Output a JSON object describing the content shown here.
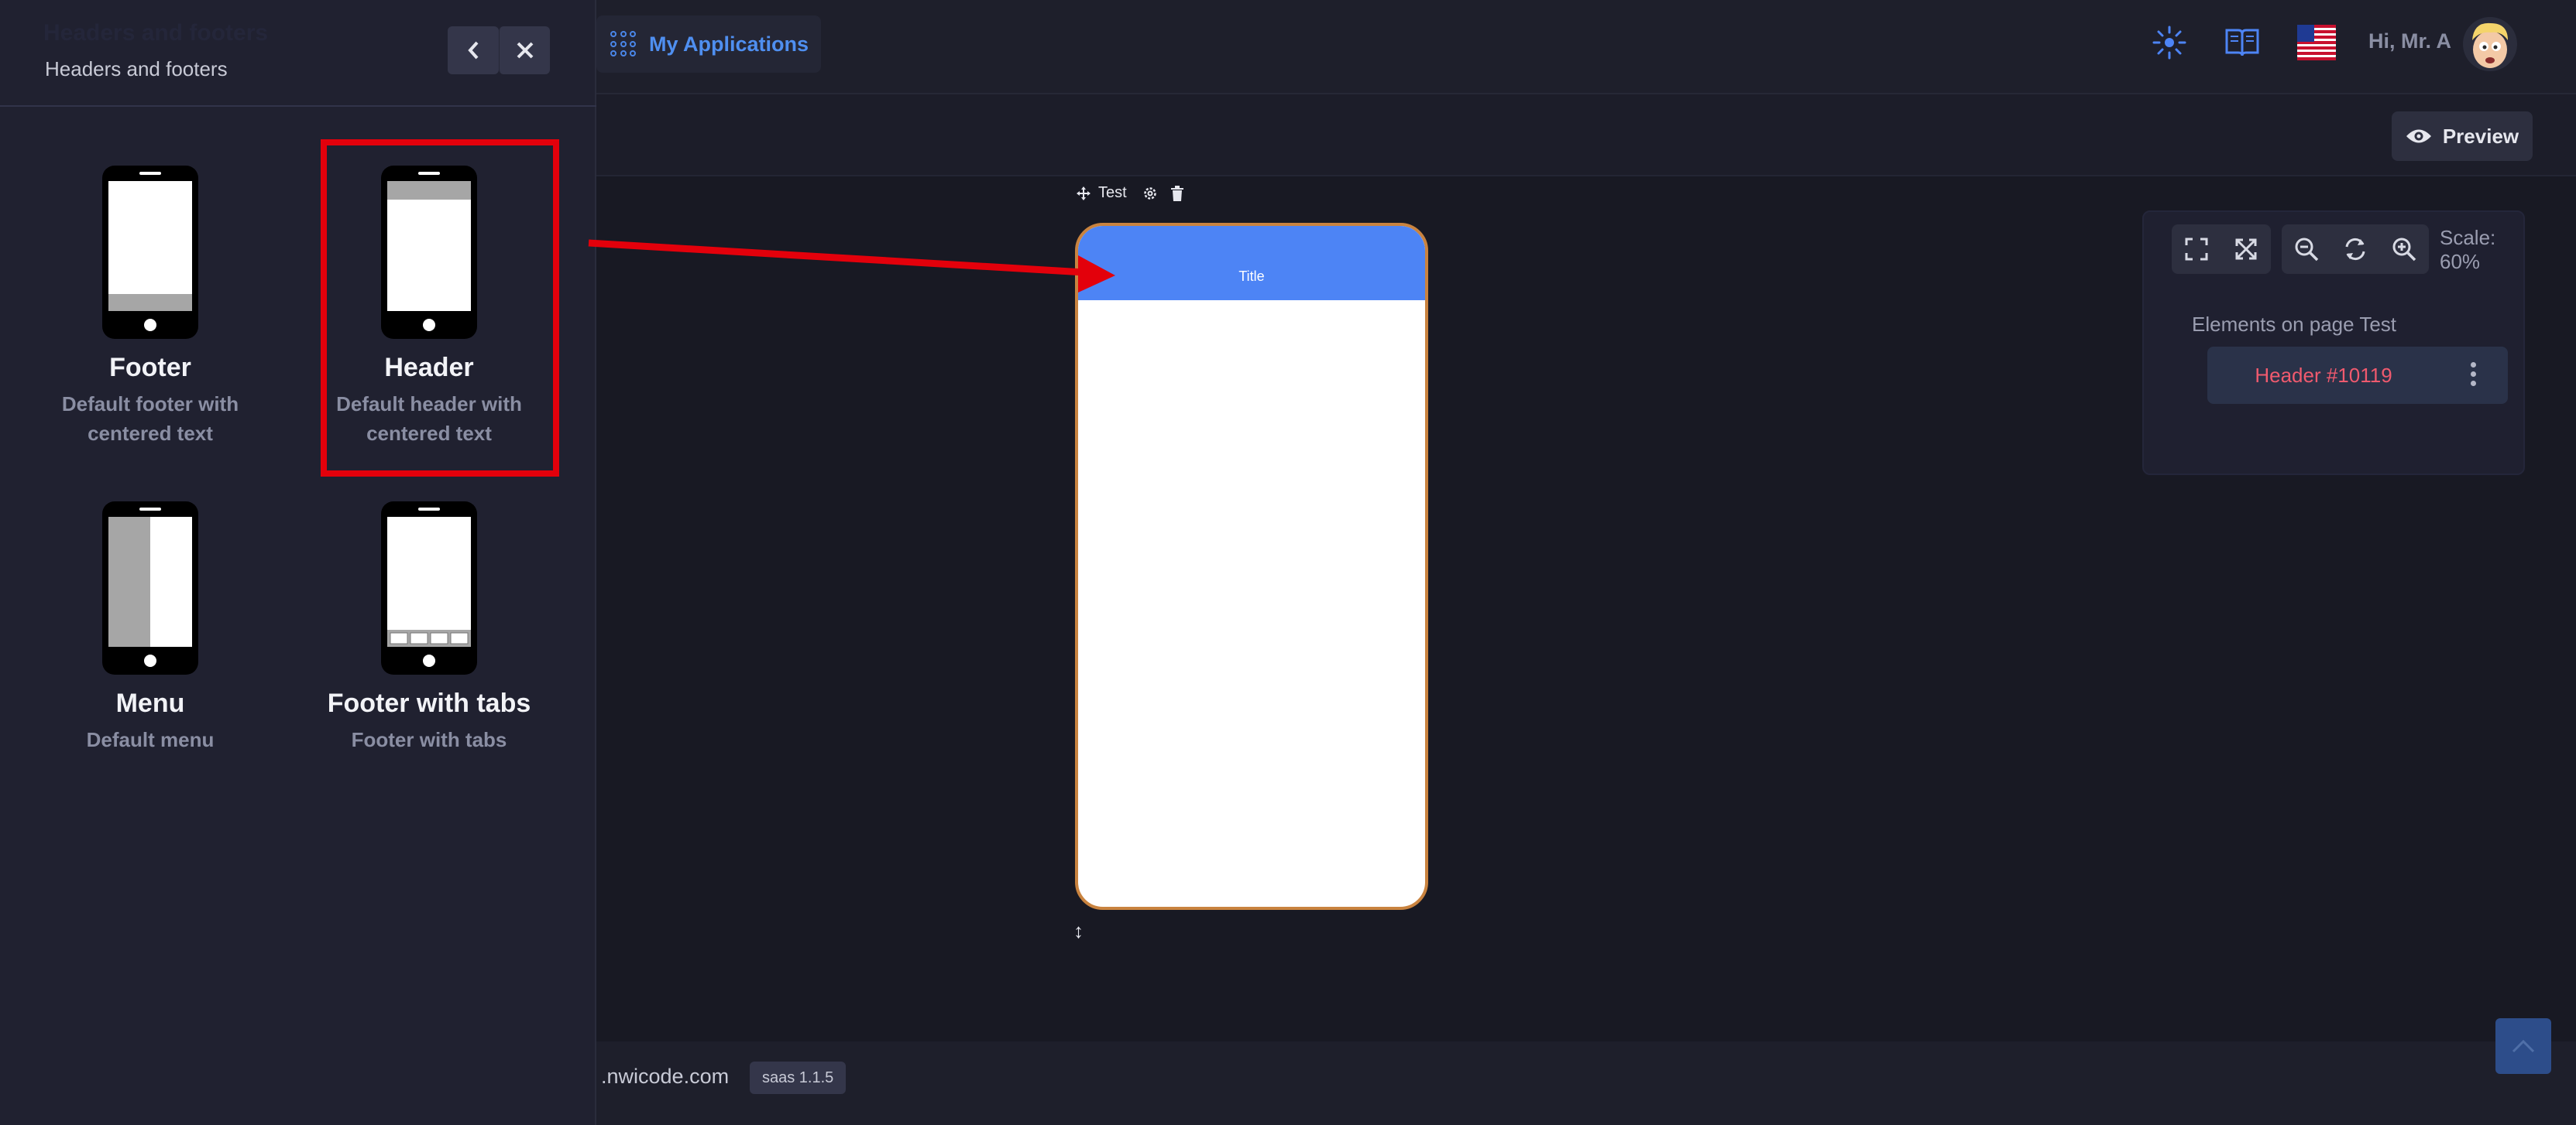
{
  "topbar": {
    "apps_label": "My Applications",
    "greeting": "Hi, Mr. A"
  },
  "toolbar": {
    "preview_label": "Preview"
  },
  "canvas": {
    "page_name": "Test",
    "phone_header_title": "Title"
  },
  "right_panel": {
    "scale_label": "Scale: 60%",
    "elements_title": "Elements on page Test",
    "elements": [
      {
        "name": "Header #10119"
      }
    ]
  },
  "footer": {
    "domain_text": ".nwicode.com",
    "version": "saas 1.1.5"
  },
  "drawer": {
    "ghost_title": "Headers and footers",
    "subtitle": "Headers and footers",
    "templates": [
      {
        "title": "Footer",
        "desc": "Default footer with centered text"
      },
      {
        "title": "Header",
        "desc": "Default header with centered text"
      },
      {
        "title": "Menu",
        "desc": "Default menu"
      },
      {
        "title": "Footer with tabs",
        "desc": "Footer with tabs"
      }
    ]
  },
  "colors": {
    "accent": "#4d84f5",
    "highlight": "#e3000b",
    "element_name": "#f05a6e",
    "phone_border": "#c9833f"
  }
}
